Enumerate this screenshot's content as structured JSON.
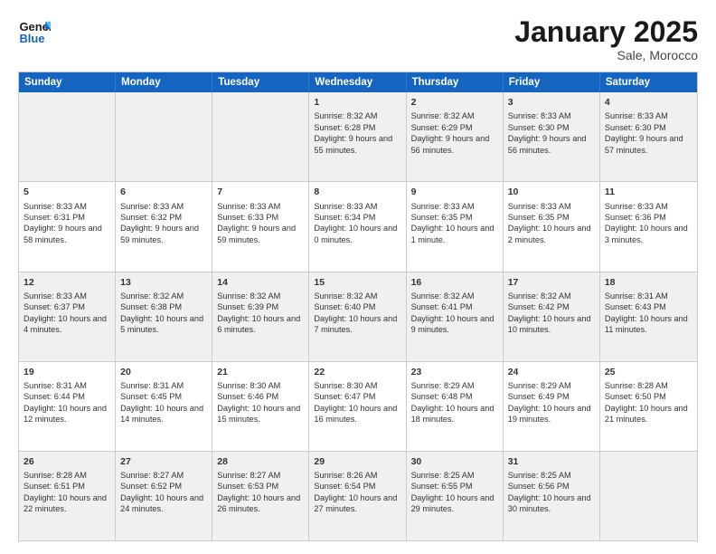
{
  "header": {
    "logo_general": "General",
    "logo_blue": "Blue",
    "month_title": "January 2025",
    "location": "Sale, Morocco"
  },
  "weekdays": [
    "Sunday",
    "Monday",
    "Tuesday",
    "Wednesday",
    "Thursday",
    "Friday",
    "Saturday"
  ],
  "rows": [
    [
      {
        "day": "",
        "content": ""
      },
      {
        "day": "",
        "content": ""
      },
      {
        "day": "",
        "content": ""
      },
      {
        "day": "1",
        "content": "Sunrise: 8:32 AM\nSunset: 6:28 PM\nDaylight: 9 hours and 55 minutes."
      },
      {
        "day": "2",
        "content": "Sunrise: 8:32 AM\nSunset: 6:29 PM\nDaylight: 9 hours and 56 minutes."
      },
      {
        "day": "3",
        "content": "Sunrise: 8:33 AM\nSunset: 6:30 PM\nDaylight: 9 hours and 56 minutes."
      },
      {
        "day": "4",
        "content": "Sunrise: 8:33 AM\nSunset: 6:30 PM\nDaylight: 9 hours and 57 minutes."
      }
    ],
    [
      {
        "day": "5",
        "content": "Sunrise: 8:33 AM\nSunset: 6:31 PM\nDaylight: 9 hours and 58 minutes."
      },
      {
        "day": "6",
        "content": "Sunrise: 8:33 AM\nSunset: 6:32 PM\nDaylight: 9 hours and 59 minutes."
      },
      {
        "day": "7",
        "content": "Sunrise: 8:33 AM\nSunset: 6:33 PM\nDaylight: 9 hours and 59 minutes."
      },
      {
        "day": "8",
        "content": "Sunrise: 8:33 AM\nSunset: 6:34 PM\nDaylight: 10 hours and 0 minutes."
      },
      {
        "day": "9",
        "content": "Sunrise: 8:33 AM\nSunset: 6:35 PM\nDaylight: 10 hours and 1 minute."
      },
      {
        "day": "10",
        "content": "Sunrise: 8:33 AM\nSunset: 6:35 PM\nDaylight: 10 hours and 2 minutes."
      },
      {
        "day": "11",
        "content": "Sunrise: 8:33 AM\nSunset: 6:36 PM\nDaylight: 10 hours and 3 minutes."
      }
    ],
    [
      {
        "day": "12",
        "content": "Sunrise: 8:33 AM\nSunset: 6:37 PM\nDaylight: 10 hours and 4 minutes."
      },
      {
        "day": "13",
        "content": "Sunrise: 8:32 AM\nSunset: 6:38 PM\nDaylight: 10 hours and 5 minutes."
      },
      {
        "day": "14",
        "content": "Sunrise: 8:32 AM\nSunset: 6:39 PM\nDaylight: 10 hours and 6 minutes."
      },
      {
        "day": "15",
        "content": "Sunrise: 8:32 AM\nSunset: 6:40 PM\nDaylight: 10 hours and 7 minutes."
      },
      {
        "day": "16",
        "content": "Sunrise: 8:32 AM\nSunset: 6:41 PM\nDaylight: 10 hours and 9 minutes."
      },
      {
        "day": "17",
        "content": "Sunrise: 8:32 AM\nSunset: 6:42 PM\nDaylight: 10 hours and 10 minutes."
      },
      {
        "day": "18",
        "content": "Sunrise: 8:31 AM\nSunset: 6:43 PM\nDaylight: 10 hours and 11 minutes."
      }
    ],
    [
      {
        "day": "19",
        "content": "Sunrise: 8:31 AM\nSunset: 6:44 PM\nDaylight: 10 hours and 12 minutes."
      },
      {
        "day": "20",
        "content": "Sunrise: 8:31 AM\nSunset: 6:45 PM\nDaylight: 10 hours and 14 minutes."
      },
      {
        "day": "21",
        "content": "Sunrise: 8:30 AM\nSunset: 6:46 PM\nDaylight: 10 hours and 15 minutes."
      },
      {
        "day": "22",
        "content": "Sunrise: 8:30 AM\nSunset: 6:47 PM\nDaylight: 10 hours and 16 minutes."
      },
      {
        "day": "23",
        "content": "Sunrise: 8:29 AM\nSunset: 6:48 PM\nDaylight: 10 hours and 18 minutes."
      },
      {
        "day": "24",
        "content": "Sunrise: 8:29 AM\nSunset: 6:49 PM\nDaylight: 10 hours and 19 minutes."
      },
      {
        "day": "25",
        "content": "Sunrise: 8:28 AM\nSunset: 6:50 PM\nDaylight: 10 hours and 21 minutes."
      }
    ],
    [
      {
        "day": "26",
        "content": "Sunrise: 8:28 AM\nSunset: 6:51 PM\nDaylight: 10 hours and 22 minutes."
      },
      {
        "day": "27",
        "content": "Sunrise: 8:27 AM\nSunset: 6:52 PM\nDaylight: 10 hours and 24 minutes."
      },
      {
        "day": "28",
        "content": "Sunrise: 8:27 AM\nSunset: 6:53 PM\nDaylight: 10 hours and 26 minutes."
      },
      {
        "day": "29",
        "content": "Sunrise: 8:26 AM\nSunset: 6:54 PM\nDaylight: 10 hours and 27 minutes."
      },
      {
        "day": "30",
        "content": "Sunrise: 8:25 AM\nSunset: 6:55 PM\nDaylight: 10 hours and 29 minutes."
      },
      {
        "day": "31",
        "content": "Sunrise: 8:25 AM\nSunset: 6:56 PM\nDaylight: 10 hours and 30 minutes."
      },
      {
        "day": "",
        "content": ""
      }
    ]
  ]
}
